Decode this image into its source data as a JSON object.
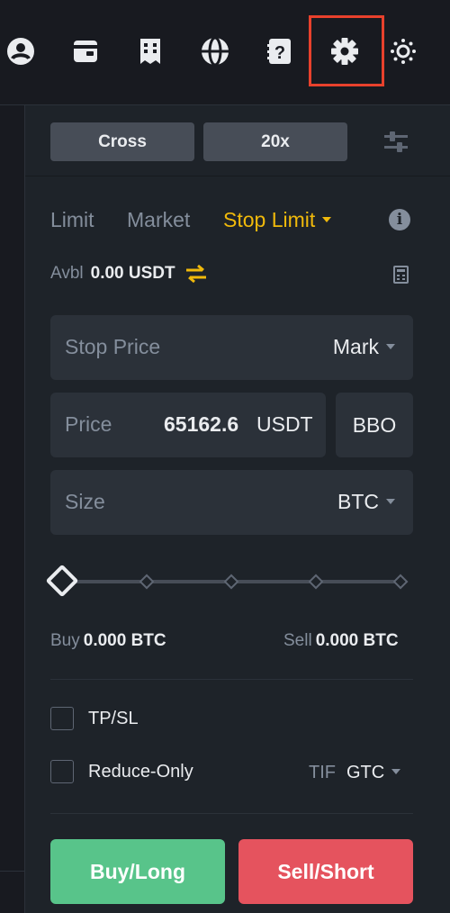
{
  "topbar": {
    "icons": [
      "account-icon",
      "wallet-icon",
      "orders-icon",
      "language-icon",
      "help-icon",
      "settings-gear-icon",
      "theme-sun-icon"
    ]
  },
  "leverage": {
    "margin_mode": "Cross",
    "leverage": "20x"
  },
  "order_types": [
    {
      "label": "Limit",
      "active": false
    },
    {
      "label": "Market",
      "active": false
    },
    {
      "label": "Stop Limit",
      "active": true
    }
  ],
  "available": {
    "label": "Avbl",
    "value": "0.00 USDT"
  },
  "stop_price": {
    "label": "Stop Price",
    "trigger": "Mark"
  },
  "price": {
    "label": "Price",
    "value": "65162.6",
    "unit": "USDT",
    "bbo": "BBO"
  },
  "size": {
    "label": "Size",
    "unit": "BTC"
  },
  "slider": {
    "percent": 0
  },
  "buy_max": {
    "label": "Buy",
    "value": "0.000 BTC"
  },
  "sell_max": {
    "label": "Sell",
    "value": "0.000 BTC"
  },
  "options": {
    "tpsl_label": "TP/SL",
    "reduce_only_label": "Reduce-Only",
    "tpsl_checked": false,
    "reduce_only_checked": false
  },
  "tif": {
    "label": "TIF",
    "value": "GTC"
  },
  "actions": {
    "buy_label": "Buy/Long",
    "sell_label": "Sell/Short"
  },
  "colors": {
    "accent": "#f0b90b",
    "buy": "#58c48a",
    "sell": "#e5535e",
    "highlight": "#e8412c"
  }
}
